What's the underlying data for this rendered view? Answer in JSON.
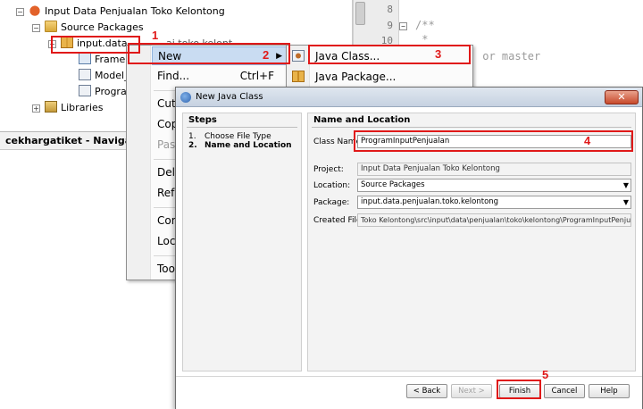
{
  "tree": {
    "project": "Input Data Penjualan Toko Kelontong",
    "source_packages": "Source Packages",
    "package": "input.data",
    "package_suffix": "ai.toko.kelont",
    "files": [
      "Frame",
      "Model_",
      "Progra"
    ],
    "libraries": "Libraries"
  },
  "navigator": {
    "title": "cekhargatiket - Navigato"
  },
  "editor": {
    "line_numbers": [
      "8",
      "9",
      "10"
    ],
    "code_lines": [
      "/**",
      " *",
      " or master"
    ]
  },
  "context_menu": {
    "items": [
      {
        "label": "New",
        "shortcut": "",
        "submenu": true
      },
      {
        "label": "Find...",
        "shortcut": "Ctrl+F"
      },
      {
        "label": "Cut"
      },
      {
        "label": "Cop"
      },
      {
        "label": "Past"
      },
      {
        "label": "Dele"
      },
      {
        "label": "Refa"
      },
      {
        "label": "Com"
      },
      {
        "label": "Loc"
      },
      {
        "label": "Too"
      }
    ]
  },
  "submenu": {
    "items": [
      {
        "label": "Java Class..."
      },
      {
        "label": "Java Package..."
      }
    ]
  },
  "dialog": {
    "title": "New Java Class",
    "steps_heading": "Steps",
    "steps": [
      {
        "n": "1.",
        "label": "Choose File Type"
      },
      {
        "n": "2.",
        "label": "Name and Location"
      }
    ],
    "section_heading": "Name and Location",
    "fields": {
      "class_name_label": "Class Name:",
      "class_name_value": "ProgramInputPenjualan",
      "project_label": "Project:",
      "project_value": "Input Data Penjualan Toko Kelontong",
      "location_label": "Location:",
      "location_value": "Source Packages",
      "package_label": "Package:",
      "package_value": "input.data.penjualan.toko.kelontong",
      "created_file_label": "Created File:",
      "created_file_value": "Toko Kelontong\\src\\input\\data\\penjualan\\toko\\kelontong\\ProgramInputPenjualano.java"
    },
    "buttons": {
      "back": "< Back",
      "next": "Next >",
      "finish": "Finish",
      "cancel": "Cancel",
      "help": "Help"
    }
  },
  "annotations": [
    "1",
    "2",
    "3",
    "4",
    "5"
  ],
  "colors": {
    "annotation": "#e01919",
    "highlight": "#c9dcf2"
  }
}
